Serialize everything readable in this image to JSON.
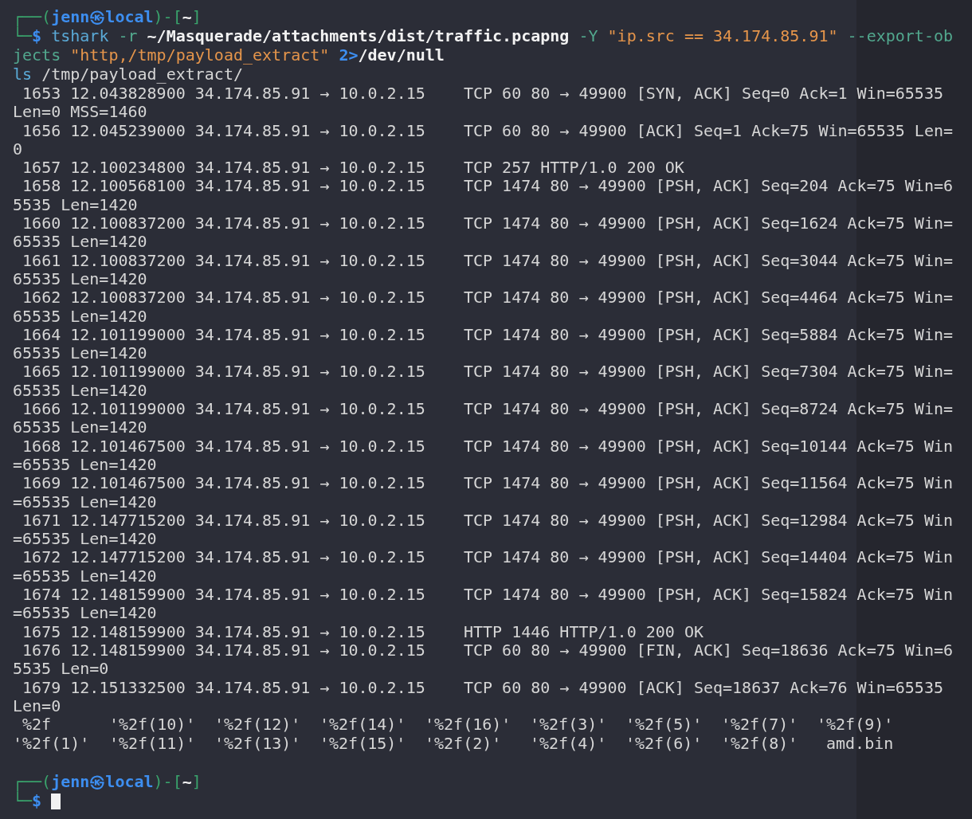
{
  "prompt": {
    "open": "┌──(",
    "user": "jenn",
    "symbol": "㉿",
    "host": "local",
    "mid": ")-[",
    "dir": "~",
    "close": "]",
    "corner": "└─",
    "sign": "$"
  },
  "command_lines": [
    [
      {
        "kind": "command",
        "text": "tshark"
      },
      {
        "kind": "option",
        "text": "-r"
      },
      {
        "kind": "path",
        "text": "~/Masquerade/attachments/dist/traffic.pcapng"
      },
      {
        "kind": "option",
        "text": "-Y"
      },
      {
        "kind": "string",
        "text": "\"ip.src == 34.174.85.91\""
      },
      {
        "kind": "option",
        "text": "--export-ob"
      }
    ],
    [
      {
        "kind": "option",
        "text": "jects"
      },
      {
        "kind": "string",
        "text": "\"http,/tmp/payload_extract\""
      },
      {
        "kind": "redirect",
        "text": "2>"
      },
      {
        "kind": "path",
        "text": "/dev/null"
      }
    ]
  ],
  "typeahead": [
    {
      "kind": "command",
      "text": "ls"
    },
    {
      "kind": "plain",
      "text": "/tmp/payload_extract/"
    }
  ],
  "packets": [
    " 1653 12.043828900 34.174.85.91 → 10.0.2.15    TCP 60 80 → 49900 [SYN, ACK] Seq=0 Ack=1 Win=65535 Len=0 MSS=1460",
    " 1656 12.045239000 34.174.85.91 → 10.0.2.15    TCP 60 80 → 49900 [ACK] Seq=1 Ack=75 Win=65535 Len=0",
    " 1657 12.100234800 34.174.85.91 → 10.0.2.15    TCP 257 HTTP/1.0 200 OK",
    " 1658 12.100568100 34.174.85.91 → 10.0.2.15    TCP 1474 80 → 49900 [PSH, ACK] Seq=204 Ack=75 Win=65535 Len=1420",
    " 1660 12.100837200 34.174.85.91 → 10.0.2.15    TCP 1474 80 → 49900 [PSH, ACK] Seq=1624 Ack=75 Win=65535 Len=1420",
    " 1661 12.100837200 34.174.85.91 → 10.0.2.15    TCP 1474 80 → 49900 [PSH, ACK] Seq=3044 Ack=75 Win=65535 Len=1420",
    " 1662 12.100837200 34.174.85.91 → 10.0.2.15    TCP 1474 80 → 49900 [PSH, ACK] Seq=4464 Ack=75 Win=65535 Len=1420",
    " 1664 12.101199000 34.174.85.91 → 10.0.2.15    TCP 1474 80 → 49900 [PSH, ACK] Seq=5884 Ack=75 Win=65535 Len=1420",
    " 1665 12.101199000 34.174.85.91 → 10.0.2.15    TCP 1474 80 → 49900 [PSH, ACK] Seq=7304 Ack=75 Win=65535 Len=1420",
    " 1666 12.101199000 34.174.85.91 → 10.0.2.15    TCP 1474 80 → 49900 [PSH, ACK] Seq=8724 Ack=75 Win=65535 Len=1420",
    " 1668 12.101467500 34.174.85.91 → 10.0.2.15    TCP 1474 80 → 49900 [PSH, ACK] Seq=10144 Ack=75 Win=65535 Len=1420",
    " 1669 12.101467500 34.174.85.91 → 10.0.2.15    TCP 1474 80 → 49900 [PSH, ACK] Seq=11564 Ack=75 Win=65535 Len=1420",
    " 1671 12.147715200 34.174.85.91 → 10.0.2.15    TCP 1474 80 → 49900 [PSH, ACK] Seq=12984 Ack=75 Win=65535 Len=1420",
    " 1672 12.147715200 34.174.85.91 → 10.0.2.15    TCP 1474 80 → 49900 [PSH, ACK] Seq=14404 Ack=75 Win=65535 Len=1420",
    " 1674 12.148159900 34.174.85.91 → 10.0.2.15    TCP 1474 80 → 49900 [PSH, ACK] Seq=15824 Ack=75 Win=65535 Len=1420",
    " 1675 12.148159900 34.174.85.91 → 10.0.2.15    HTTP 1446 HTTP/1.0 200 OK",
    " 1676 12.148159900 34.174.85.91 → 10.0.2.15    TCP 60 80 → 49900 [FIN, ACK] Seq=18636 Ack=75 Win=65535 Len=0",
    " 1679 12.151332500 34.174.85.91 → 10.0.2.15    TCP 60 80 → 49900 [ACK] Seq=18637 Ack=76 Win=65535 Len=0"
  ],
  "listing": [
    [
      "%2f",
      "'%2f(10)'",
      "'%2f(12)'",
      "'%2f(14)'",
      "'%2f(16)'",
      "'%2f(3)'",
      "'%2f(5)'",
      "'%2f(7)'",
      "'%2f(9)'"
    ],
    [
      "'%2f(1)'",
      "'%2f(11)'",
      "'%2f(13)'",
      "'%2f(15)'",
      "'%2f(2)'",
      "'%2f(4)'",
      "'%2f(6)'",
      "'%2f(8)'",
      "amd.bin"
    ]
  ],
  "final_prompt": {
    "open": "┌──(",
    "user": "jenn",
    "symbol": "㉿",
    "host": "local",
    "mid": ")-[",
    "dir": "~",
    "close": "]",
    "corner": "└─",
    "sign": "$"
  }
}
